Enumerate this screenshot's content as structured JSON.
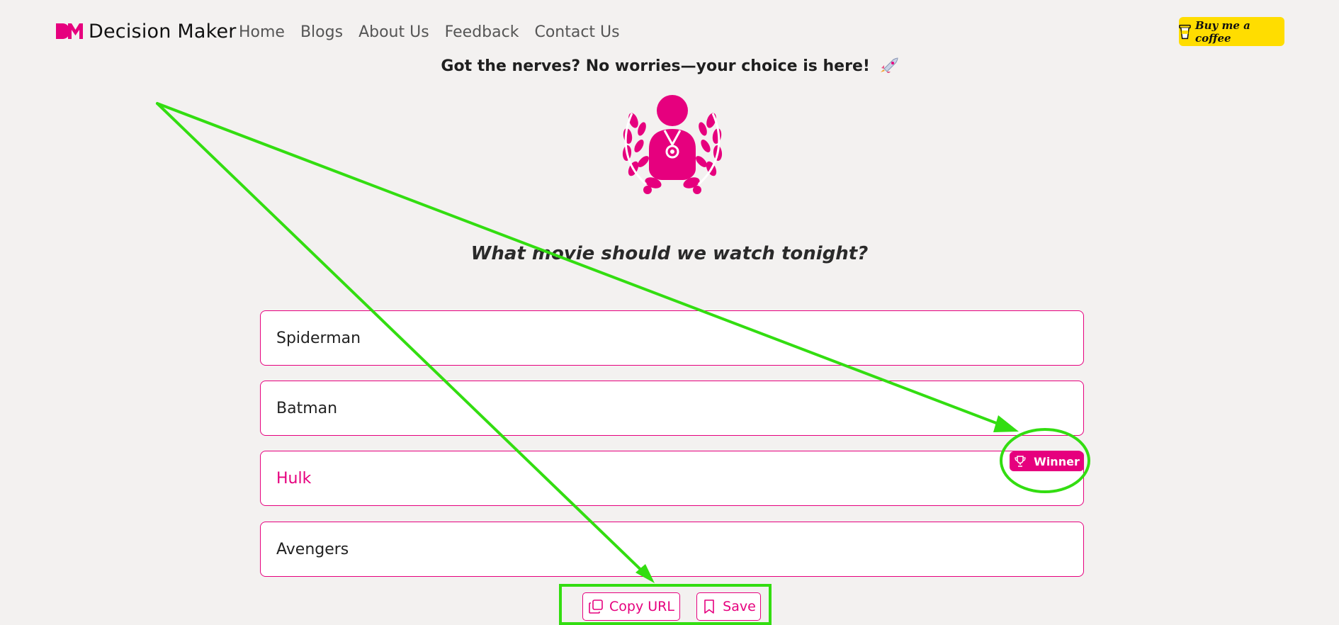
{
  "navbar": {
    "brand_name": "Decision Maker",
    "links": [
      "Home",
      "Blogs",
      "About Us",
      "Feedback",
      "Contact Us"
    ],
    "coffee_button": "Buy me a coffee"
  },
  "main": {
    "tagline": "Got the nerves? No worries—your choice is here!",
    "question": "What movie should we watch tonight?",
    "options": [
      "Spiderman",
      "Batman",
      "Hulk",
      "Avengers"
    ],
    "winner_badge": "Winner",
    "copy_button": "Copy URL",
    "save_button": "Save"
  },
  "colors": {
    "accent": "#e6007e",
    "coffee_yellow": "#ffdd00",
    "annotation_green": "#33dd11",
    "background": "#f3f1f0"
  },
  "icons": [
    "dm-logo-icon",
    "coffee-cup-icon",
    "rocket-icon",
    "winner-laurel-icon",
    "trophy-icon",
    "copy-icon",
    "bookmark-icon"
  ]
}
